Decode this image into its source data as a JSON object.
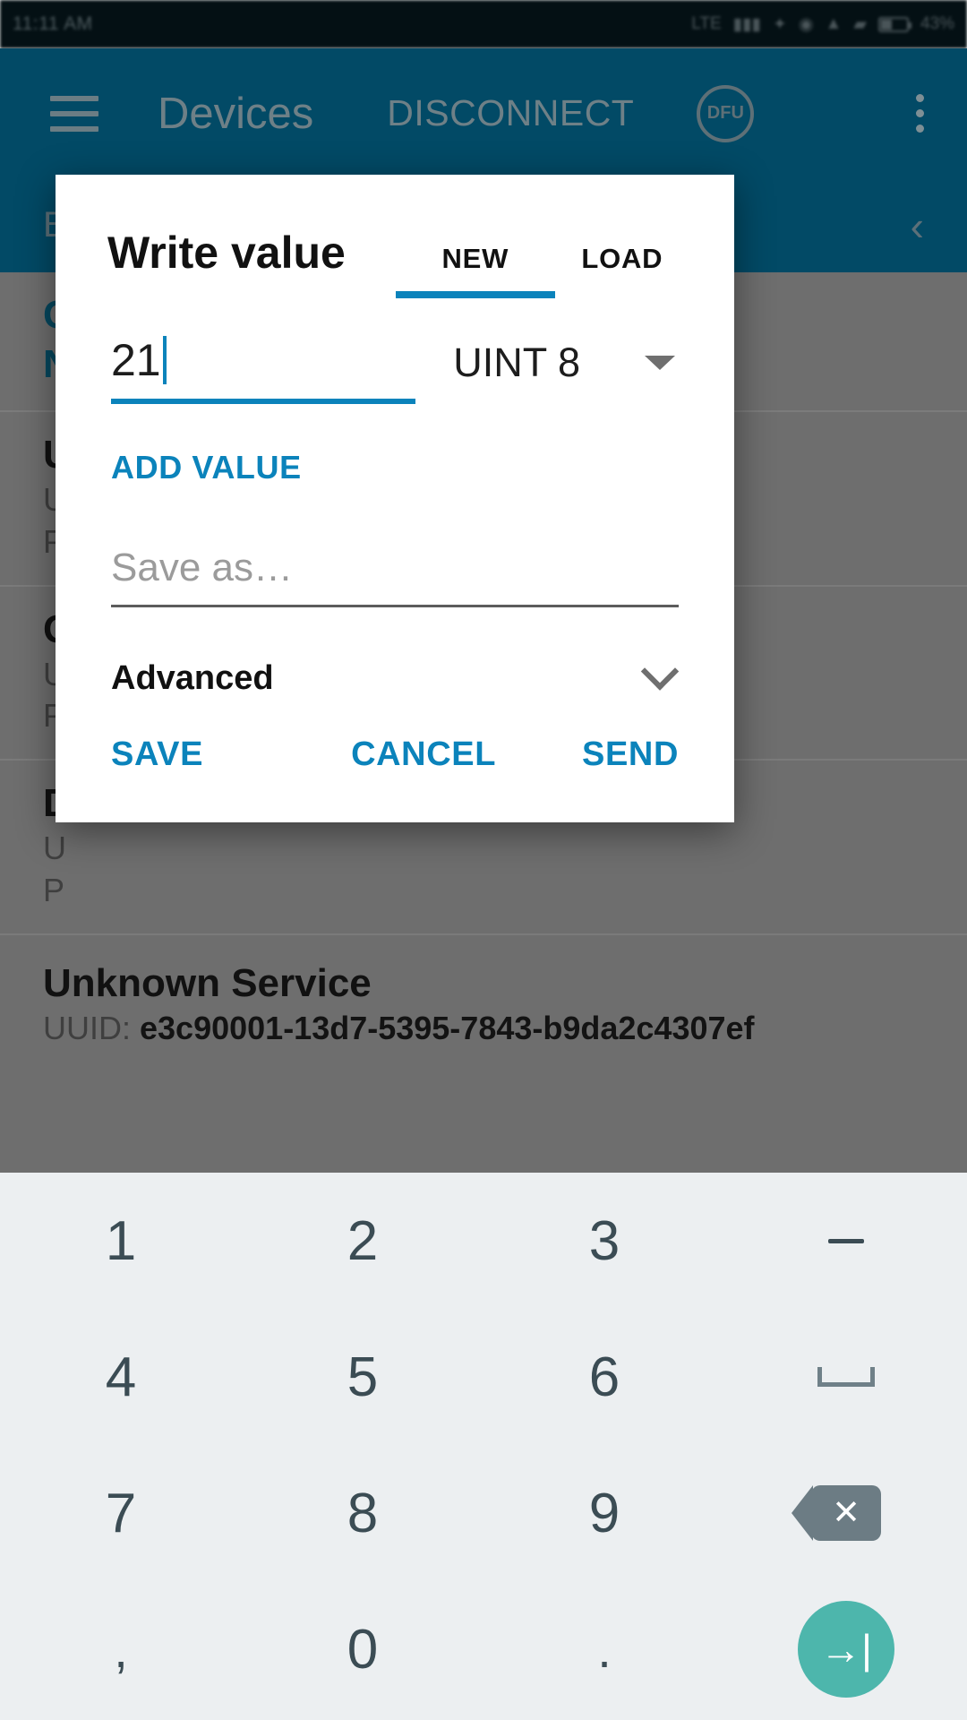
{
  "statusbar": {
    "time": "11:11 AM",
    "icons": [
      "lte-label",
      "carrier-text",
      "bluetooth-icon",
      "alarm-icon",
      "wifi-icon",
      "signal-icon",
      "data-speed",
      "battery-icon"
    ],
    "battery_percent": "43%"
  },
  "appbar": {
    "menu_icon": "hamburger-menu-icon",
    "title": "Devices",
    "disconnect_label": "DISCONNECT",
    "dfu_label": "DFU",
    "overflow_icon": "overflow-menu-icon"
  },
  "background": {
    "subbar_text": "B",
    "collapse_icon": "chevron-left-icon",
    "items": [
      {
        "title": "C",
        "subtitle": "N",
        "line3": ""
      },
      {
        "title": "U",
        "subtitle": "U",
        "line3": "P"
      },
      {
        "title": "G",
        "subtitle": "U",
        "line3": "P"
      },
      {
        "title": "D",
        "subtitle": "U",
        "line3": "P"
      }
    ],
    "last_service": {
      "name": "Unknown Service",
      "uuid_label": "UUID:",
      "uuid_value": "e3c90001-13d7-5395-7843-b9da2c4307ef"
    }
  },
  "dialog": {
    "title": "Write value",
    "tabs": [
      {
        "label": "NEW",
        "active": true
      },
      {
        "label": "LOAD",
        "active": false
      }
    ],
    "value_input": {
      "value": "21",
      "placeholder": ""
    },
    "type_select": {
      "selected": "UINT 8",
      "icon": "chevron-down-icon"
    },
    "add_value_label": "ADD VALUE",
    "save_as_input": {
      "value": "",
      "placeholder": "Save as…"
    },
    "advanced": {
      "label": "Advanced",
      "icon": "chevron-down-icon",
      "expanded": false
    },
    "actions": {
      "save": "SAVE",
      "cancel": "CANCEL",
      "send": "SEND"
    },
    "accent_color": "#0b83bb"
  },
  "keyboard": {
    "type": "numeric",
    "rows": [
      [
        "1",
        "2",
        "3",
        "minus-key"
      ],
      [
        "4",
        "5",
        "6",
        "space-key"
      ],
      [
        "7",
        "8",
        "9",
        "backspace-key"
      ],
      [
        ",",
        "0",
        ".",
        "enter-key"
      ]
    ],
    "keys": {
      "k1": "1",
      "k2": "2",
      "k3": "3",
      "k4": "4",
      "k5": "5",
      "k6": "6",
      "k7": "7",
      "k8": "8",
      "k9": "9",
      "kcomma": ",",
      "k0": "0",
      "kdot": ".",
      "minus": "–",
      "backspace_glyph": "✕",
      "enter_glyph": "→|"
    },
    "enter_color": "#4db6ac"
  }
}
